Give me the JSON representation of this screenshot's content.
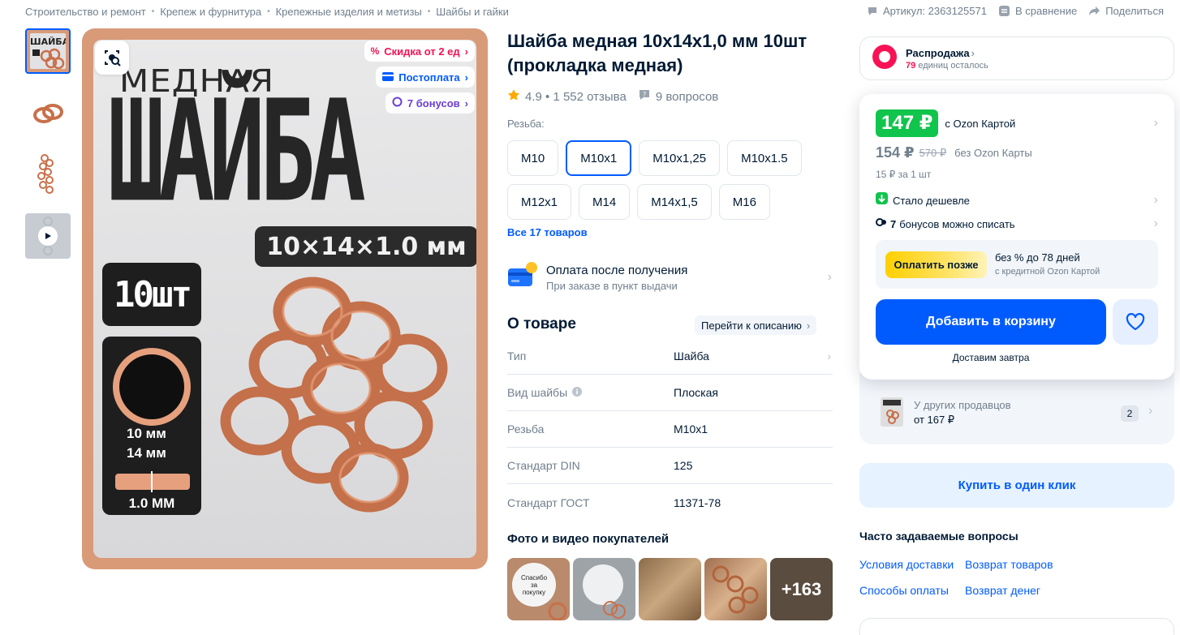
{
  "breadcrumbs": [
    "Строительство и ремонт",
    "Крепеж и фурнитура",
    "Крепежные изделия и метизы",
    "Шайбы и гайки"
  ],
  "top_actions": {
    "article": "Артикул: 2363125571",
    "compare": "В сравнение",
    "share": "Поделиться"
  },
  "image": {
    "promo_discount": "Скидка от 2 ед",
    "promo_postpay": "Постоплата",
    "promo_bonus": "7 бонусов",
    "line1": "МЕДНАЯ",
    "line2": "ШАЙБА",
    "size": "10×14×1.0 мм",
    "count": "10шт",
    "dim_inner": "10 мм",
    "dim_outer": "14 мм",
    "dim_thick": "1.0 ММ",
    "thumb_title": "ШАЙБА"
  },
  "product": {
    "title": "Шайба медная 10х14х1,0 мм 10шт (прокладка медная)",
    "rating": "4.9 • 1 552 отзыва",
    "questions": "9 вопросов",
    "variant_label": "Резьба:",
    "variants": [
      "M10",
      "M10x1",
      "M10x1,25",
      "M10x1.5",
      "M12x1",
      "M14",
      "M14x1,5",
      "M16"
    ],
    "selected_variant": "M10x1",
    "all_items": "Все 17 товаров",
    "payafter_title": "Оплата после получения",
    "payafter_sub": "При заказе в пункт выдачи",
    "about_title": "О товаре",
    "goto_desc": "Перейти к описанию",
    "props": [
      {
        "k": "Тип",
        "v": "Шайба"
      },
      {
        "k": "Вид шайбы",
        "v": "Плоская"
      },
      {
        "k": "Резьба",
        "v": "M10x1"
      },
      {
        "k": "Стандарт DIN",
        "v": "125"
      },
      {
        "k": "Стандарт ГОСТ",
        "v": "11371-78"
      }
    ],
    "photos_title": "Фото и видео покупателей",
    "photos_more": "+163",
    "review_card_text": "Спасибо за покупку"
  },
  "buy": {
    "sale_title": "Распродажа",
    "sale_count": "79",
    "sale_rest": "единиц осталось",
    "price_card": "147 ₽",
    "price_card_label": "с Ozon Картой",
    "price_regular": "154 ₽",
    "price_old": "570 ₽",
    "price_regular_label": "без Ozon Карты",
    "unit_price": "15 ₽ за 1 шт",
    "cheaper": "Стало дешевле",
    "bonus_count": "7",
    "bonus_text": "бонусов можно списать",
    "later_btn": "Оплатить позже",
    "later_title": "без % до 78 дней",
    "later_sub": "с кредитной Ozon Картой",
    "add_to_cart": "Добавить в корзину",
    "delivery": "Доставим завтра",
    "other_sellers": "У других продавцов",
    "other_price": "от 167 ₽",
    "other_count": "2",
    "one_click": "Купить в один клик",
    "faq_title": "Часто задаваемые вопросы",
    "faq": [
      "Условия доставки",
      "Возврат товаров",
      "Способы оплаты",
      "Возврат денег"
    ]
  },
  "colors": {
    "accent": "#005bff",
    "green": "#10c44c",
    "copper": "#c8704a",
    "sale_pink": "#f91155"
  }
}
